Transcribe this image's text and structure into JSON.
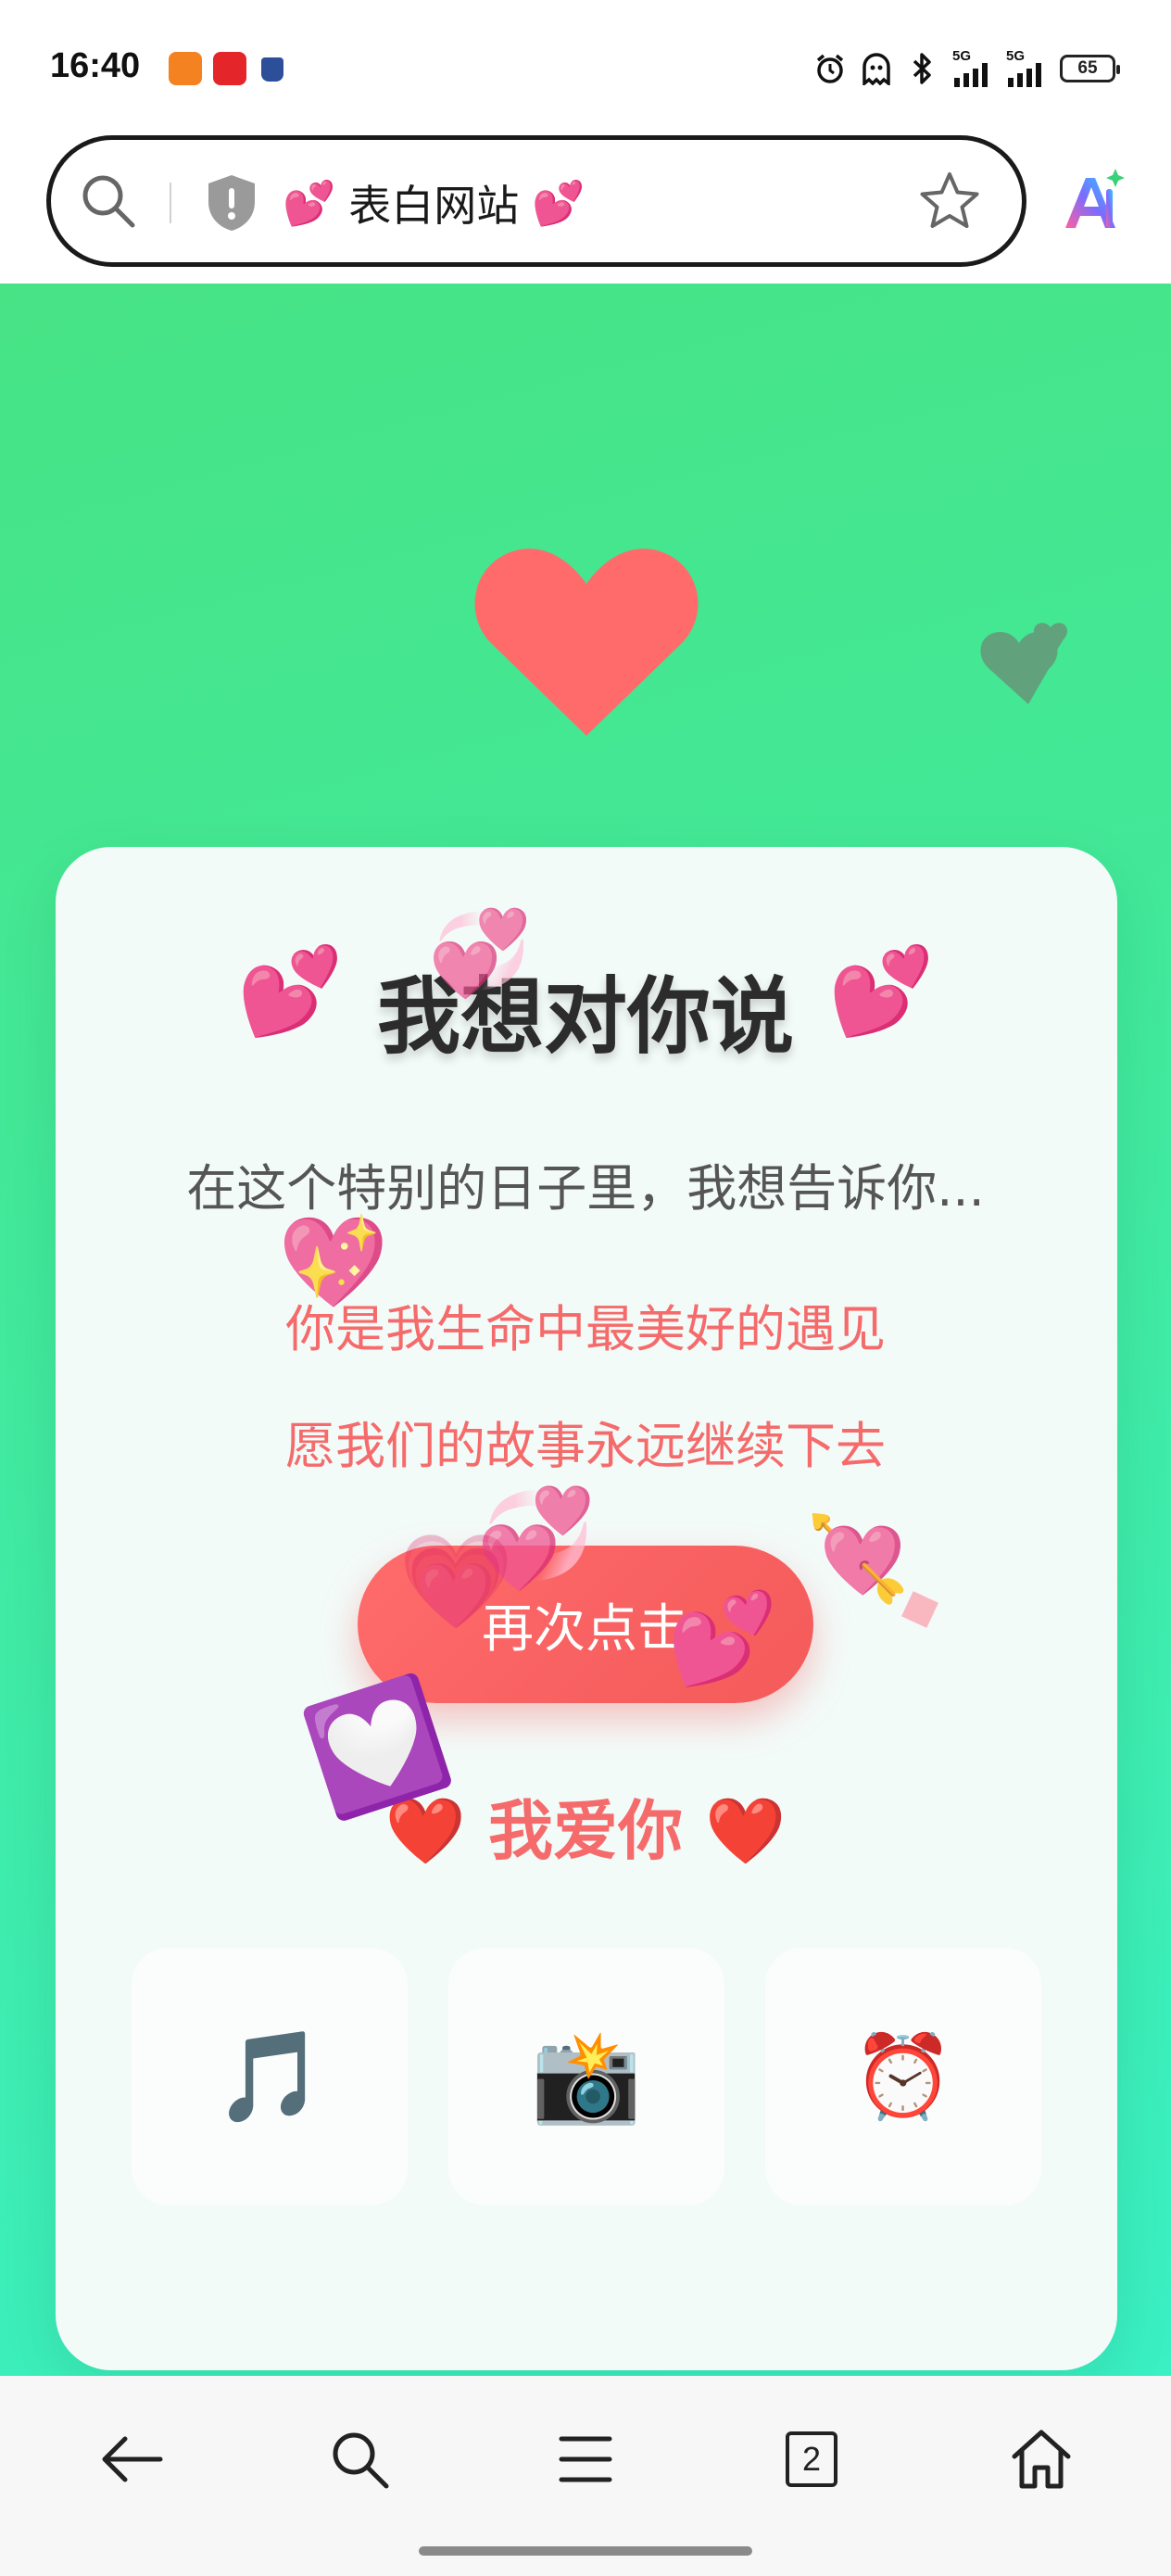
{
  "status_bar": {
    "time": "16:40",
    "network_1": "5G",
    "network_2": "5G",
    "battery": "65"
  },
  "address_bar": {
    "title_emoji_left": "💕",
    "title": "表白网站",
    "title_emoji_right": "💕"
  },
  "card": {
    "title": "我想对你说",
    "title_emoji": "💕",
    "subtitle": "在这个特别的日子里，我想告诉你...",
    "line1": "你是我生命中最美好的遇见",
    "line2": "愿我们的故事永远继续下去",
    "button_label": "再次点击",
    "love_text": "❤️ 我爱你 ❤️",
    "tiles": [
      {
        "icon": "music-note-icon",
        "glyph": "🎵"
      },
      {
        "icon": "camera-icon",
        "glyph": "📸"
      },
      {
        "icon": "alarm-clock-icon",
        "glyph": "⏰"
      }
    ]
  },
  "decorations": {
    "floating_hearts": [
      "💗",
      "💖",
      "💞",
      "💘",
      "💟",
      "💕",
      "💚"
    ]
  },
  "bottom_nav": {
    "tab_count": "2"
  },
  "colors": {
    "accent": "#f56b6b",
    "background_top": "#47e385",
    "background_bottom": "#3af0c4"
  }
}
